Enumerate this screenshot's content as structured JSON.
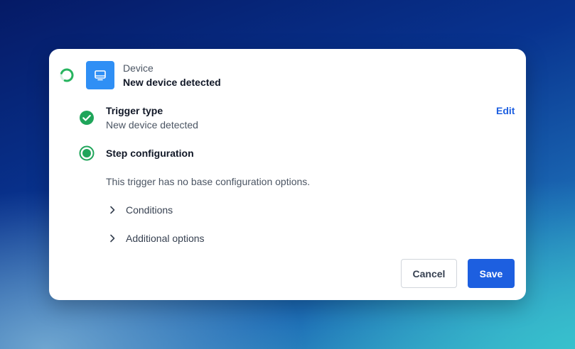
{
  "header": {
    "kicker": "Device",
    "title": "New device detected",
    "tile_icon": "monitor-icon",
    "status_icon": "loading-spinner-icon"
  },
  "steps": [
    {
      "title": "Trigger type",
      "value": "New device detected",
      "status": "complete",
      "action_label": "Edit"
    },
    {
      "title": "Step configuration",
      "status": "active",
      "description": "This trigger has no base configuration options."
    }
  ],
  "sections": [
    {
      "label": "Conditions",
      "expanded": false
    },
    {
      "label": "Additional options",
      "expanded": false
    }
  ],
  "footer": {
    "cancel_label": "Cancel",
    "save_label": "Save"
  },
  "colors": {
    "primary": "#1d5fe0",
    "success": "#1fa55a",
    "tile": "#2f8ff5"
  }
}
